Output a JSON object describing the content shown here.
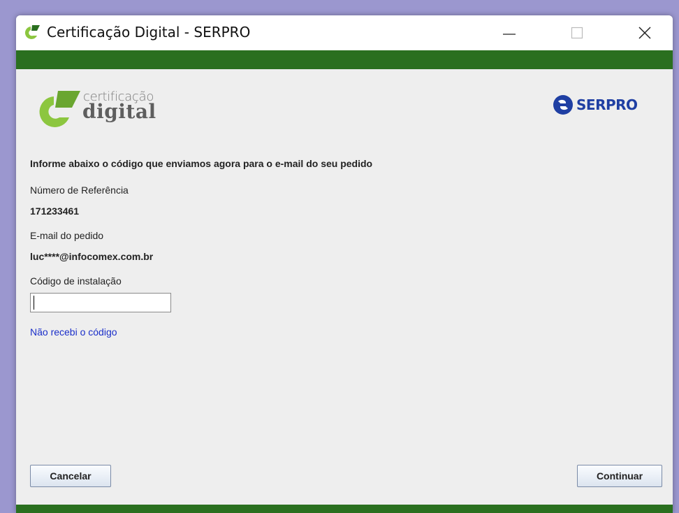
{
  "window": {
    "title": "Certificação Digital - SERPRO",
    "controls": {
      "minimize_icon": "minimize-icon",
      "maximize_icon": "maximize-icon",
      "close_icon": "close-icon"
    }
  },
  "branding": {
    "logo_small": "certificação",
    "logo_big": "digital",
    "partner": "SERPRO",
    "accent_green": "#2a6f1f",
    "logo_green": "#8cc63f",
    "partner_blue": "#1f3fa3"
  },
  "form": {
    "instruction": "Informe abaixo o código que enviamos agora para o e-mail do seu pedido",
    "reference_label": "Número de Referência",
    "reference_value": "171233461",
    "email_label": "E-mail do pedido",
    "email_value": "luc****@infocomex.com.br",
    "code_label": "Código de instalação",
    "code_value": "",
    "resend_link": "Não recebi o código"
  },
  "buttons": {
    "cancel": "Cancelar",
    "continue": "Continuar"
  }
}
